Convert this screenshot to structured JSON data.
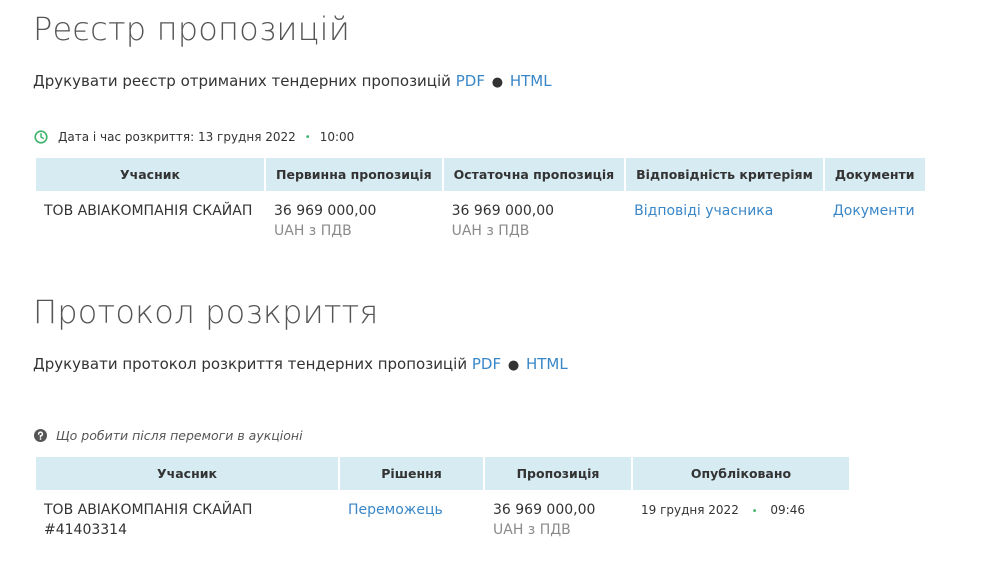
{
  "registry": {
    "title": "Реєстр пропозицій",
    "print_text": "Друкувати реєстр отриманих тендерних пропозицій",
    "pdf_label": "PDF",
    "html_label": "HTML",
    "bullet": "●",
    "opening_label": "Дата і час розкриття: 13 грудня 2022",
    "opening_time": "10:00",
    "headers": [
      "Учасник",
      "Первинна пропозиція",
      "Остаточна пропозиція",
      "Відповідність критеріям",
      "Документи"
    ],
    "rows": [
      {
        "participant": "ТОВ АВІАКОМПАНІЯ СКАЙАП",
        "initial_amount": "36 969 000,00",
        "initial_currency": "UAH з ПДВ",
        "final_amount": "36 969 000,00",
        "final_currency": "UAH з ПДВ",
        "criteria_link": "Відповіді учасника",
        "documents_link": "Документи"
      }
    ]
  },
  "protocol": {
    "title": "Протокол розкриття",
    "print_text": "Друкувати протокол розкриття тендерних пропозицій",
    "pdf_label": "PDF",
    "html_label": "HTML",
    "bullet": "●",
    "help_text": "Що робити після перемоги в аукціоні",
    "headers": [
      "Учасник",
      "Рішення",
      "Пропозиція",
      "Опубліковано"
    ],
    "rows": [
      {
        "participant": "ТОВ АВІАКОМПАНІЯ СКАЙАП",
        "participant_id": "#41403314",
        "decision_link": "Переможець",
        "amount": "36 969 000,00",
        "currency": "UAH з ПДВ",
        "published_date": "19 грудня 2022",
        "published_time": "09:46"
      }
    ]
  },
  "colors": {
    "link": "#3a87c7",
    "header_bg": "#d7ebf3",
    "clock_icon": "#3eb36b",
    "help_icon": "#555555"
  },
  "icons": {
    "clock": "clock-icon",
    "help": "question-circle-icon"
  }
}
